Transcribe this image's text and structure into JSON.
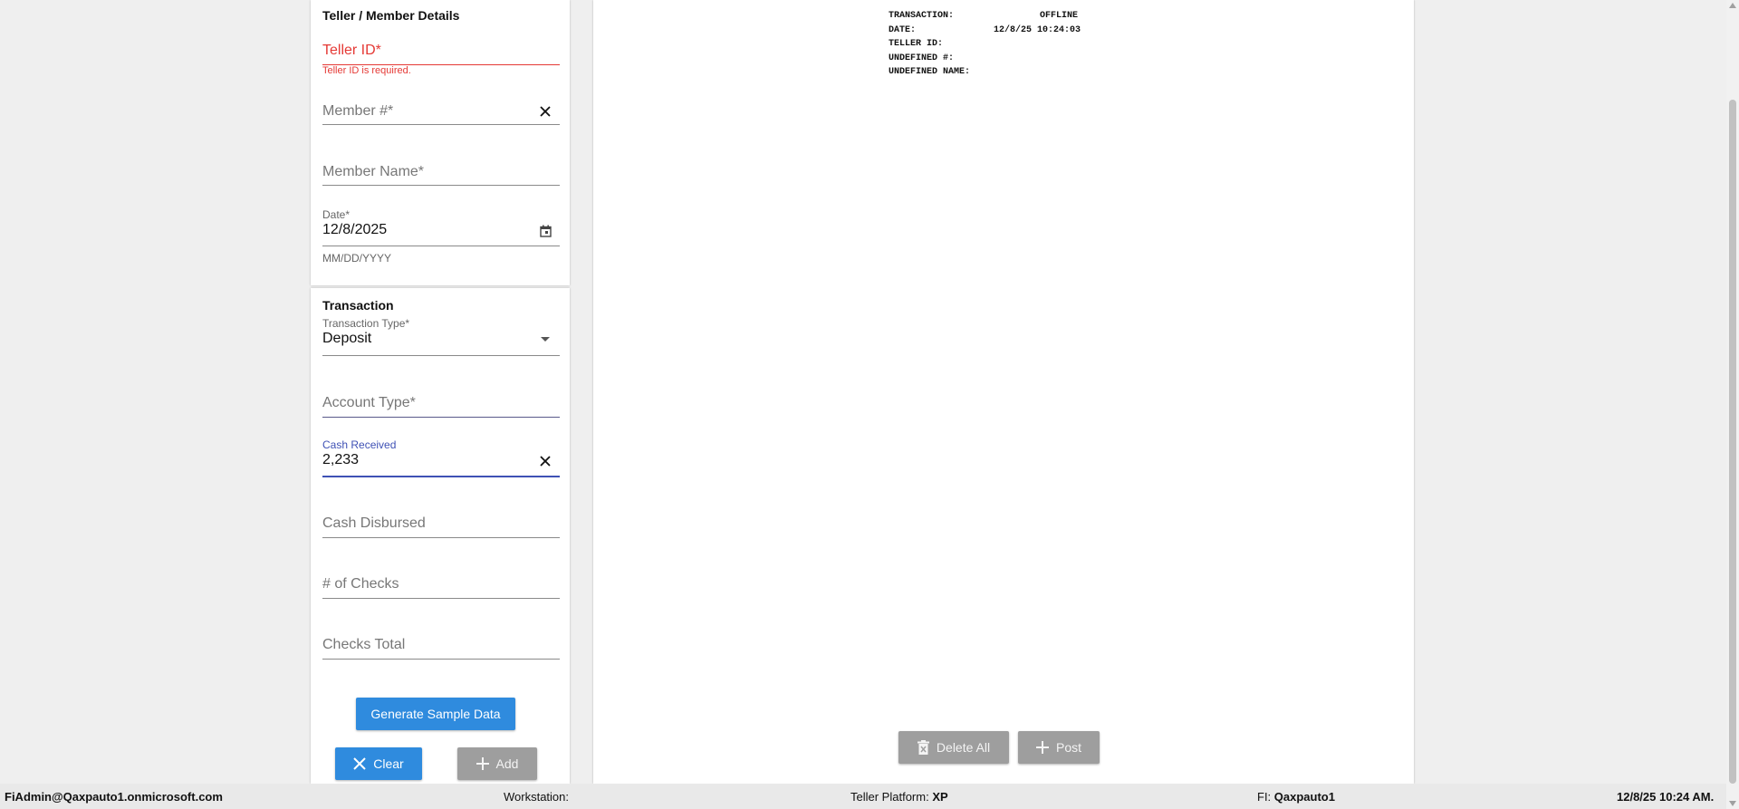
{
  "teller_section": {
    "title": "Teller / Member Details",
    "teller_id": {
      "placeholder": "Teller ID*",
      "error": "Teller ID is required."
    },
    "member_number": {
      "placeholder": "Member #*"
    },
    "member_name": {
      "placeholder": "Member Name*"
    },
    "date": {
      "label": "Date*",
      "value": "12/8/2025",
      "hint": "MM/DD/YYYY"
    }
  },
  "transaction_section": {
    "title": "Transaction",
    "transaction_type": {
      "label": "Transaction Type*",
      "value": "Deposit"
    },
    "account_type": {
      "placeholder": "Account Type*"
    },
    "cash_received": {
      "label": "Cash Received",
      "value": "2,233"
    },
    "cash_disbursed": {
      "placeholder": "Cash Disbursed"
    },
    "num_checks": {
      "placeholder": "# of Checks"
    },
    "checks_total": {
      "placeholder": "Checks Total"
    },
    "generate_label": "Generate Sample Data",
    "clear_label": "Clear",
    "add_label": "Add"
  },
  "receipt": {
    "rows": [
      {
        "key": "TRANSACTION:",
        "value": "OFFLINE"
      },
      {
        "key": "DATE:",
        "value": "12/8/25 10:24:03"
      },
      {
        "key": "TELLER ID:",
        "value": ""
      },
      {
        "key": "UNDEFINED #:",
        "value": ""
      },
      {
        "key": "UNDEFINED NAME:",
        "value": ""
      }
    ],
    "delete_all_label": "Delete All",
    "post_label": "Post"
  },
  "status_bar": {
    "user": "FiAdmin@Qaxpauto1.onmicrosoft.com",
    "workstation_label": "Workstation:",
    "platform_label": "Teller Platform:",
    "platform_value": "XP",
    "fi_label": "FI:",
    "fi_value": "Qaxpauto1",
    "datetime": "12/8/25 10:24 AM."
  },
  "colors": {
    "primary": "#2f8bde",
    "error": "#e53935",
    "focus": "#3f51b5",
    "disabled": "#9e9e9e"
  }
}
